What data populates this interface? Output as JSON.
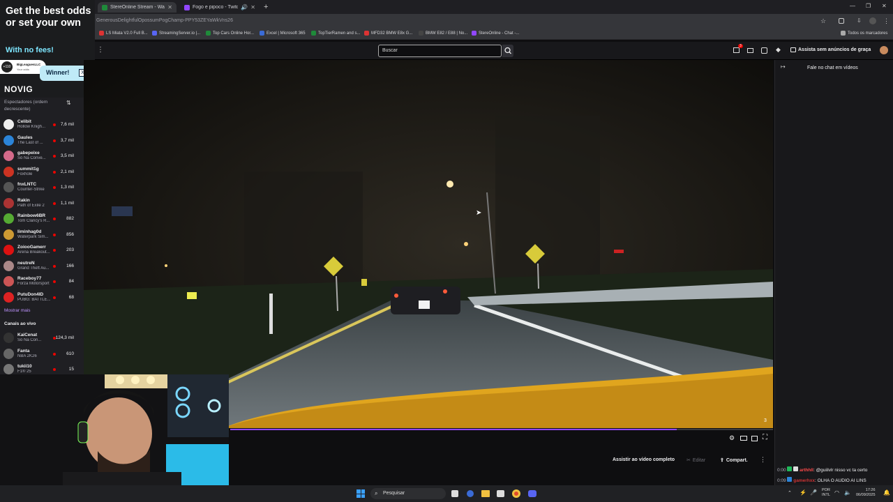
{
  "browser": {
    "tabs": [
      {
        "label": "StereOnline Stream - Watch Live",
        "active": true,
        "color": "#1f8a3a"
      },
      {
        "label": "Fogo e pipoco - Twitch",
        "active": false,
        "color": "#9147ff"
      }
    ],
    "url": "GenerousDelightfulOpossumPogChamp-PPY53ZEYaWkVns26",
    "bookmarks": [
      {
        "label": "LS Miata V2.0 Full B...",
        "color": "#d33"
      },
      {
        "label": "StreamingServer.io |...",
        "color": "#5865f2"
      },
      {
        "label": "Top Cars Online Hor...",
        "color": "#1f8a3a"
      },
      {
        "label": "Excel | Microsoft 365",
        "color": "#3a6bd6"
      },
      {
        "label": "TopTierRamen and s...",
        "color": "#1f8a3a"
      },
      {
        "label": "MFD32 BMW E8x G...",
        "color": "#d33"
      },
      {
        "label": "BMW E82 / E88 | No...",
        "color": "#444"
      },
      {
        "label": "StereOnline - Chat -...",
        "color": "#9147ff"
      }
    ],
    "all_bookmarks": "Todos os marcadores"
  },
  "ad": {
    "headline": "Get the best odds or set your own",
    "subline": "With no fees!",
    "winner_label": "Winner!",
    "brand": "NOVIG",
    "plus_label": "+110",
    "user_label": "BigLeaguesLLC",
    "user_sub": "Your odds"
  },
  "twitch": {
    "search_placeholder": "Buscar",
    "notification_count": "3",
    "adfree_label": "Assista sem anúncios de graça",
    "sidebar": {
      "sort_label": "Espectadores (ordem decrescente)",
      "channels": [
        {
          "name": "Celibit",
          "game": "Hollow Knigh...",
          "viewers": "7,6 mil",
          "color": "#eee"
        },
        {
          "name": "Gaules",
          "game": "The Last of ...",
          "viewers": "3,7 mil",
          "color": "#2b84d8"
        },
        {
          "name": "gabepeixe",
          "game": "Só Na Conve...",
          "viewers": "3,5 mil",
          "color": "#d46a8a"
        },
        {
          "name": "summit1g",
          "game": "Foxhole",
          "viewers": "2,1 mil",
          "color": "#c32"
        },
        {
          "name": "fnxLNTC",
          "game": "Counter-Strike",
          "viewers": "1,3 mil",
          "color": "#555"
        },
        {
          "name": "Rakin",
          "game": "Path of Exile 2",
          "viewers": "1,1 mil",
          "color": "#a33"
        },
        {
          "name": "Rainbow6BR",
          "game": "Tom Clancy's R...",
          "viewers": "882",
          "color": "#5a3"
        },
        {
          "name": "liminhag0d",
          "game": "Waterpark Sim...",
          "viewers": "856",
          "color": "#c93"
        },
        {
          "name": "ZoiooGamerr",
          "game": "Arena Breakout...",
          "viewers": "203",
          "color": "#d11"
        },
        {
          "name": "neutreN",
          "game": "Grand Theft Au...",
          "viewers": "166",
          "color": "#a88"
        },
        {
          "name": "Raceboy77",
          "game": "Forza Motorsport",
          "viewers": "84",
          "color": "#c55"
        },
        {
          "name": "PutuDon4ID",
          "game": "PUBG: BATTLE...",
          "viewers": "68",
          "color": "#d22"
        }
      ],
      "show_more": "Mostrar mais",
      "live_heading": "Canais ao vivo",
      "live_channels": [
        {
          "name": "KaiCenat",
          "game": "Só Na Con...",
          "viewers": "124,3 mil",
          "color": "#333"
        },
        {
          "name": "Fanta",
          "game": "NBA 2K26",
          "viewers": "610",
          "color": "#666"
        },
        {
          "name": "tukii10",
          "game": "F1® 25",
          "viewers": "15",
          "color": "#777"
        }
      ]
    },
    "video_counter": "3",
    "watch_full": "Assistir ao vídeo completo",
    "edit_label": "Editar",
    "share_label": "Compart.",
    "chat": {
      "header": "Fale no chat em vídeos",
      "messages": [
        {
          "time": "0:00",
          "user": "arthhll",
          "user_color": "#ff4a4a",
          "text": ": @guiilvlr nisso vc ta certo"
        },
        {
          "time": "0:09",
          "user": "gamerhxx",
          "user_color": "#c33",
          "text": ": OLHA O AUDIO AI LINS"
        }
      ]
    }
  },
  "taskbar": {
    "search_label": "Pesquisar",
    "lang_top": "POR",
    "lang_bottom": "INTL",
    "time": "17:26",
    "date": "06/09/2025"
  }
}
